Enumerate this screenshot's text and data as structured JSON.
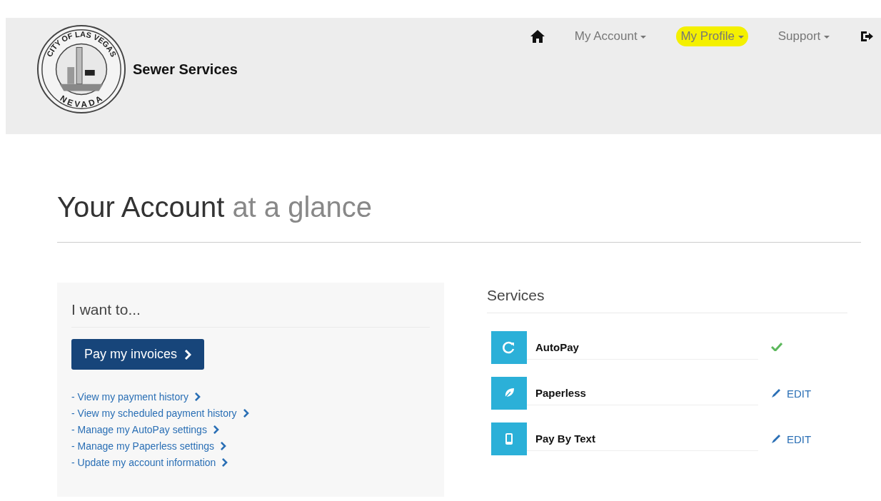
{
  "logo": {
    "top_text": "CITY OF LAS VEGAS",
    "bottom_text": "NEVADA"
  },
  "brand": "Sewer Services",
  "nav": [
    {
      "kind": "home"
    },
    {
      "kind": "menu",
      "label": "My Account",
      "highlighted": false
    },
    {
      "kind": "menu",
      "label": "My Profile",
      "highlighted": true
    },
    {
      "kind": "menu",
      "label": "Support",
      "highlighted": false
    },
    {
      "kind": "logout"
    }
  ],
  "title": {
    "main": "Your Account",
    "rest": "at a glance"
  },
  "i_want_to": {
    "heading": "I want to...",
    "button": "Pay my invoices",
    "links": [
      {
        "dash": "-",
        "label": "View my payment history"
      },
      {
        "dash": "-",
        "label": "View my scheduled payment history"
      },
      {
        "dash": "-",
        "label": "Manage my AutoPay settings"
      },
      {
        "dash": "-",
        "label": "Manage my Paperless settings"
      },
      {
        "dash": "-",
        "label": "Update my account information"
      }
    ]
  },
  "services": {
    "heading": "Services",
    "items": [
      {
        "kind": "refresh",
        "name": "AutoPay",
        "action": {
          "kind": "check"
        }
      },
      {
        "kind": "leaf",
        "name": "Paperless",
        "action": {
          "kind": "edit",
          "label": "EDIT"
        }
      },
      {
        "kind": "phone",
        "name": "Pay By Text",
        "action": {
          "kind": "edit",
          "label": "EDIT"
        }
      }
    ]
  }
}
